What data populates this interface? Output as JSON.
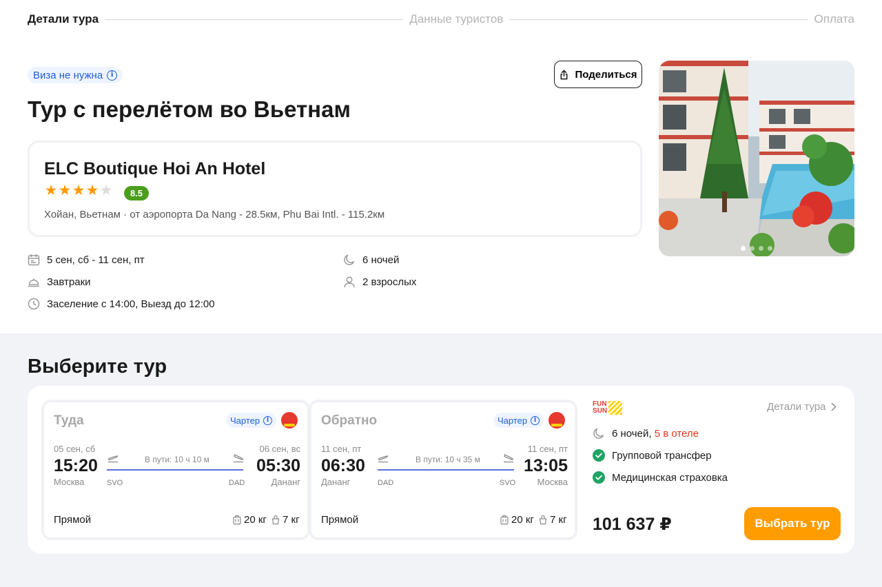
{
  "stepper": {
    "steps": [
      "Детали тура",
      "Данные туристов",
      "Оплата"
    ]
  },
  "visa_badge": "Виза не нужна",
  "share_label": "Поделиться",
  "page_title": "Тур с перелётом во Вьетнам",
  "hotel": {
    "name": "ELC Boutique Hoi An Hotel",
    "stars": 4,
    "stars_max": 5,
    "rating": "8.5",
    "location": "Хойан, Вьетнам · от аэропорта Da Nang - 28.5км, Phu Bai Intl. - 115.2км",
    "photo_count": 4,
    "photo_active": 1
  },
  "details": {
    "dates": "5 сен, сб - 11 сен, пт",
    "nights": "6 ночей",
    "meals": "Завтраки",
    "guests": "2 взрослых",
    "checkin": "Заселение с 14:00, Выезд до 12:00"
  },
  "section_title": "Выберите тур",
  "flights": [
    {
      "direction": "Туда",
      "type": "Чартер",
      "dep_date": "05 сен, сб",
      "dep_time": "15:20",
      "dep_city": "Москва",
      "dep_code": "SVO",
      "duration": "В пути: 10 ч 10 м",
      "arr_date": "06 сен, вс",
      "arr_time": "05:30",
      "arr_city": "Дананг",
      "arr_code": "DAD",
      "stops": "Прямой",
      "baggage": "20 кг",
      "hand_luggage": "7 кг"
    },
    {
      "direction": "Обратно",
      "type": "Чартер",
      "dep_date": "11 сен, пт",
      "dep_time": "06:30",
      "dep_city": "Дананг",
      "dep_code": "DAD",
      "duration": "В пути: 10 ч 35 м",
      "arr_date": "11 сен, пт",
      "arr_time": "13:05",
      "arr_city": "Москва",
      "arr_code": "SVO",
      "stops": "Прямой",
      "baggage": "20 кг",
      "hand_luggage": "7 кг"
    }
  ],
  "offer": {
    "operator_logo": [
      "FUN",
      "SUN"
    ],
    "details_link": "Детали тура",
    "nights": "6 ночей,",
    "nights_hotel": "5 в отеле",
    "features": [
      "Групповой трансфер",
      "Медицинская страховка"
    ],
    "price": "101 637 ₽",
    "select_label": "Выбрать тур"
  },
  "colors": {
    "accent": "#ff9c00",
    "rating": "#4b9e1b",
    "check": "#1fa463",
    "link_blue": "#1e5fd8",
    "highlight_red": "#e2371f"
  }
}
